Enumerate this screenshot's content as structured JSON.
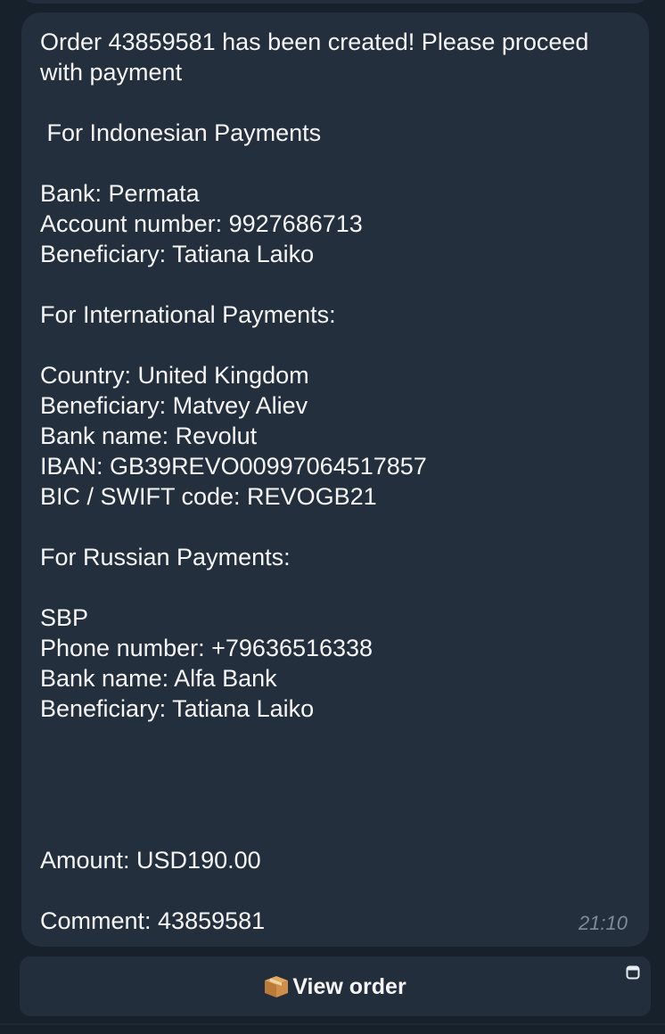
{
  "message": {
    "text": "Order 43859581 has been created! Please proceed with payment\n\n For Indonesian Payments\n\nBank: Permata\nAccount number: 9927686713\nBeneficiary: Tatiana Laiko\n\nFor International Payments:\n\nCountry: United Kingdom\nBeneficiary: Matvey Aliev\nBank name: Revolut\nIBAN: GB39REVO00997064517857\nBIC / SWIFT code: REVOGB21\n\nFor Russian Payments:\n\nSBP\nPhone number: +79636516338\nBank name: Alfa Bank\nBeneficiary: Tatiana Laiko\n\n\n\n\nAmount: USD190.00\n\nComment: 43859581",
    "time": "21:10"
  },
  "keyboard": {
    "button_icon": "package-icon",
    "button_label": "View order",
    "corner_icon": "web-app-icon"
  },
  "colors": {
    "background": "#17212b",
    "bubble": "#242f3d",
    "text": "#f5f5f5",
    "time": "#7f8b99"
  }
}
